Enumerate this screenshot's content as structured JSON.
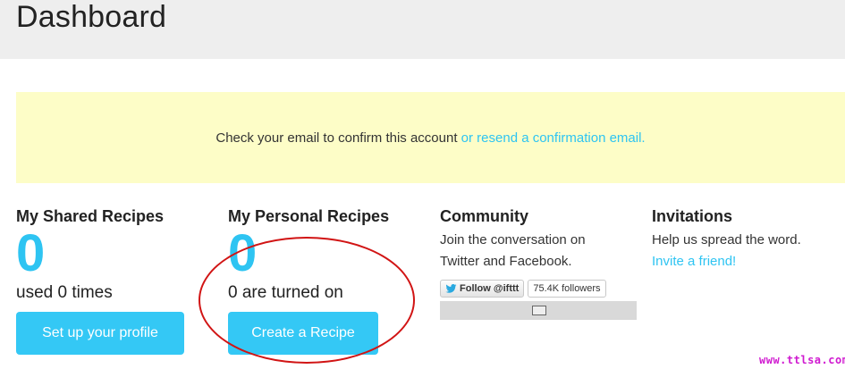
{
  "header": {
    "title": "Dashboard"
  },
  "notice": {
    "text": "Check your email to confirm this account",
    "link": "or resend a confirmation email."
  },
  "shared": {
    "title": "My Shared Recipes",
    "count": "0",
    "sub": "used 0 times",
    "button": "Set up your profile"
  },
  "personal": {
    "title": "My Personal Recipes",
    "count": "0",
    "sub": "0 are turned on",
    "button": "Create a Recipe"
  },
  "community": {
    "title": "Community",
    "line1": "Join the conversation on",
    "line2": "Twitter and Facebook.",
    "follow": "Follow @ifttt",
    "followers": "75.4K followers"
  },
  "invitations": {
    "title": "Invitations",
    "text": "Help us spread the word.",
    "link": "Invite a friend!"
  },
  "watermark": "www.ttlsa.com",
  "colors": {
    "accent": "#2ec4f2",
    "button": "#34c8f5",
    "notice_bg": "#fdfdc7",
    "annotation": "#d11414"
  }
}
